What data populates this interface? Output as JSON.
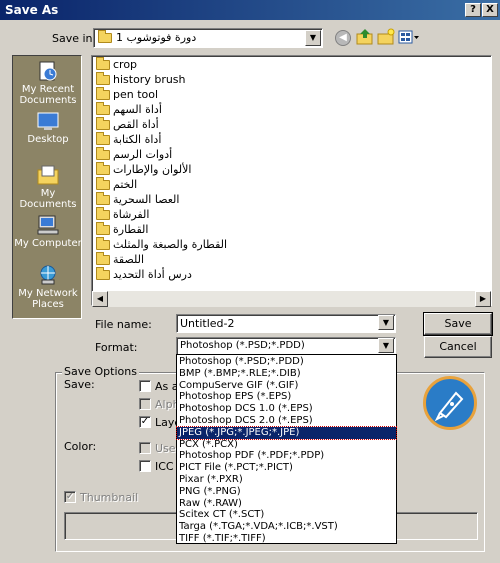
{
  "window": {
    "title": "Save As",
    "help_btn": "?",
    "close_btn": "X"
  },
  "save_in": {
    "label": "Save in:",
    "value": "دورة فوتوشوب 1"
  },
  "places": [
    {
      "label": "My Recent Documents",
      "icon": "recent-documents-icon"
    },
    {
      "label": "Desktop",
      "icon": "desktop-icon"
    },
    {
      "label": "My Documents",
      "icon": "my-documents-icon"
    },
    {
      "label": "My Computer",
      "icon": "my-computer-icon"
    },
    {
      "label": "My Network Places",
      "icon": "network-places-icon"
    }
  ],
  "files": [
    "crop",
    "history brush",
    "pen tool",
    "أداة السهم",
    "أداة القص",
    "أداة الكتابة",
    "أدوات الرسم",
    "الألوان والإطارات",
    "الختم",
    "العصا السحرية",
    "الفرشاة",
    "القطارة",
    "القطارة والصبغة والمثلث",
    "اللصقة",
    "درس أداة التحديد"
  ],
  "filename": {
    "label": "File name:",
    "value": "Untitled-2"
  },
  "format": {
    "label": "Format:",
    "value": "Photoshop (*.PSD;*.PDD)"
  },
  "buttons": {
    "save": "Save",
    "cancel": "Cancel"
  },
  "save_options": {
    "title": "Save Options",
    "save_label": "Save:",
    "as_copy": "As a",
    "alpha": "Alph",
    "layers": "Laye",
    "color_label": "Color:",
    "use_proof": "Use",
    "icc": "ICC P",
    "thumbnail": "Thumbnail"
  },
  "format_options": [
    "Photoshop (*.PSD;*.PDD)",
    "BMP (*.BMP;*.RLE;*.DIB)",
    "CompuServe GIF (*.GIF)",
    "Photoshop EPS (*.EPS)",
    "Photoshop DCS 1.0 (*.EPS)",
    "Photoshop DCS 2.0 (*.EPS)",
    "JPEG (*.JPG;*.JPEG;*.JPE)",
    "PCX (*.PCX)",
    "Photoshop PDF (*.PDF;*.PDP)",
    "PICT File (*.PCT;*.PICT)",
    "Pixar (*.PXR)",
    "PNG (*.PNG)",
    "Raw (*.RAW)",
    "Scitex CT (*.SCT)",
    "Targa (*.TGA;*.VDA;*.ICB;*.VST)",
    "TIFF (*.TIF;*.TIFF)"
  ],
  "selected_format_index": 6,
  "colors": {
    "titlebar": "#0a246a",
    "places_bg": "#8c8466",
    "selection": "#0a246a"
  }
}
